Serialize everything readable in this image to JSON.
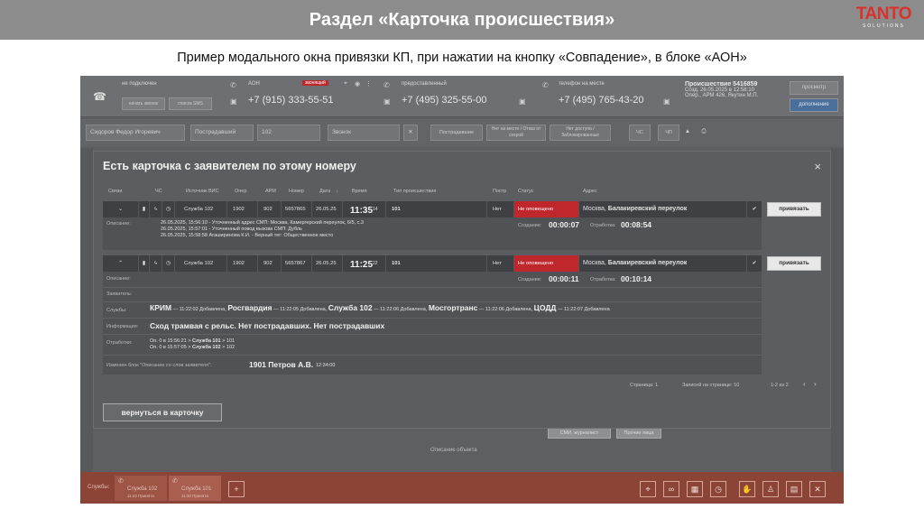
{
  "slide": {
    "title": "Раздел «Карточка происшествия»",
    "subtitle": "Пример модального окна привязки КП, при нажатии на кнопку «Совпадение», в блоке «АОН»",
    "logo_main": "TANTO",
    "logo_sub": "SOLUTIONS"
  },
  "topbar": {
    "status1": "не подключен",
    "btn_call": "начать звонок",
    "btn_sms": "список SMS",
    "aon_label": "АОН",
    "aon_badge": "звонящий",
    "aon_number": "+7 (915) 333-55-51",
    "num2_label": "предоставленный",
    "num2": "+7 (495) 325-55-00",
    "num3_label": "телефон на месте",
    "num3": "+7 (495) 765-43-20",
    "incident_title": "Происшествие 5416859",
    "incident_meta1": "Созд. 26.05.2025 в 12:58:10",
    "incident_meta2": "Опер., АРМ 426, Якутин М.П.",
    "btn_view": "просмотр",
    "btn_extra": "дополнение"
  },
  "row2": {
    "name": "Сидоров Федор Игоревич",
    "role": "Пострадавший",
    "service": "102",
    "call_type": "Звонок",
    "btn_victims": "Пострадавшие",
    "btn_nobody1": "Нет на месте / Отказ от скорой",
    "btn_nobody2": "Нет доступа / Заблокированные",
    "tag1": "ЧС",
    "tag2": "ЧП"
  },
  "modal": {
    "title": "Есть карточка с заявителем по этому номеру",
    "close": "×",
    "headers": [
      "Связи",
      "ЧС",
      "Источник ВИС",
      "Опер",
      "АРМ",
      "Номер",
      "Дата",
      "Время",
      "Тип происшествия",
      "Постр",
      "Статус",
      "Адрес"
    ],
    "rows": [
      {
        "source": "Служба 102",
        "oper": "1902",
        "arm": "902",
        "number": "5657865",
        "date": "26.05.25",
        "time": "11:35",
        "time_sec": "14",
        "type": "101",
        "victims": "Нет",
        "status": "Не оповещено",
        "city": "Москва,",
        "street": "Балакиревский переулок",
        "bind": "привязать",
        "desc_label": "Описание:",
        "desc_lines": [
          "26.05.2025, 15:56:10 - Уточненный адрес СМП: Москва, Камергерский переулок, 6/5, с.3",
          "26.05.2025, 15:57:01 - Уточненный повод вызова СМП: Дубль",
          "26.05.2025, 15:58:58 Агаширинова К.И. - Верный тег: Общественное место"
        ],
        "created_label": "Создание:",
        "created": "00:00:07",
        "processing_label": "Отработка:",
        "processing": "00:08:54"
      },
      {
        "source": "Служба 102",
        "oper": "1902",
        "arm": "902",
        "number": "5657867",
        "date": "26.05.25",
        "time": "11:25",
        "time_sec": "22",
        "type": "101",
        "victims": "Нет",
        "status": "Не оповещено",
        "city": "Москва,",
        "street": "Балакиревский переулок",
        "bind": "привязать",
        "created_label": "Создание:",
        "created": "00:00:11",
        "processing_label": "Отработка:",
        "processing": "00:10:14"
      }
    ],
    "detail2": {
      "desc_label": "Описание:",
      "applicant_label": "Заявитель:",
      "services_label": "Службы:",
      "services": [
        {
          "name": "КРИМ",
          "note": "— 11:22:02 Добавлена,"
        },
        {
          "name": "Росгвардия",
          "note": "— 11:22:05 Добавлена,"
        },
        {
          "name": "Служба 102",
          "note": "— 11:22:06 Добавлена,"
        },
        {
          "name": "Мосгортранс",
          "note": "— 11:22:06 Добавлена,"
        },
        {
          "name": "ЦОДД",
          "note": "— 11:22:07 Добавлена"
        }
      ],
      "info_label": "Информация:",
      "info": "Сход трамвая с рельс. Нет пострадавших. Нет пострадавших",
      "work_label": "Отработки:",
      "work1a": "Оп. 0 в 15:56:21 >",
      "work1b": "Служба 101",
      "work1c": "> 101",
      "work2a": "Оп. 0 в 15:57:05 >",
      "work2b": "Служба 102",
      "work2c": "> 102",
      "changed_label": "Изменен блок \"Описание со слов заявителя\":",
      "changed_who": "1901 Петров А.В.",
      "changed_time": "12:34:00"
    },
    "pager": {
      "page": "Страница: 1",
      "per_page": "Записей на странице: 10",
      "range": "1-2 из 2",
      "prev": "‹",
      "next": "›"
    },
    "back": "вернуться в карточку"
  },
  "lower": {
    "btn_smi": "СМИ, журналист",
    "btn_other": "Прочие лица",
    "object_desc": "Описание объекта"
  },
  "bottombar": {
    "label": "Службы:",
    "tab1": "Служба 102",
    "tab1_sub": "11:22 Принята",
    "tab2": "Служба 101",
    "tab2_sub": "11:30 Принята",
    "add": "+"
  },
  "colors": {
    "accent_red": "#c0272d",
    "header_gray": "#8c8c8c",
    "bottom_bar": "#8c4436"
  }
}
